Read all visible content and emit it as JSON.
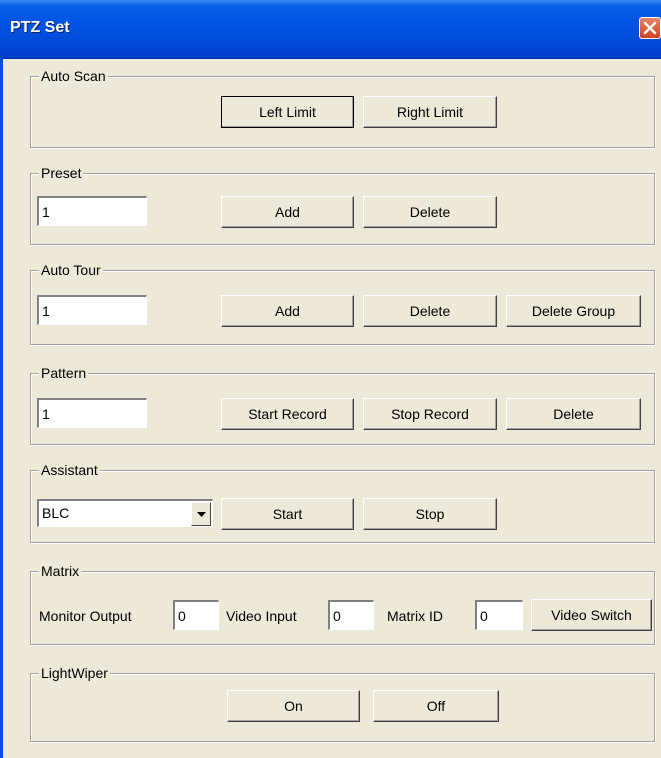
{
  "window": {
    "title": "PTZ Set"
  },
  "auto_scan": {
    "label": "Auto Scan",
    "left_limit": "Left Limit",
    "right_limit": "Right Limit"
  },
  "preset": {
    "label": "Preset",
    "value": "1",
    "add": "Add",
    "delete": "Delete"
  },
  "auto_tour": {
    "label": "Auto Tour",
    "value": "1",
    "add": "Add",
    "delete": "Delete",
    "delete_group": "Delete Group"
  },
  "pattern": {
    "label": "Pattern",
    "value": "1",
    "start_record": "Start Record",
    "stop_record": "Stop Record",
    "delete": "Delete"
  },
  "assistant": {
    "label": "Assistant",
    "selected": "BLC",
    "start": "Start",
    "stop": "Stop"
  },
  "matrix": {
    "label": "Matrix",
    "monitor_output_label": "Monitor Output",
    "monitor_output_value": "0",
    "video_input_label": "Video Input",
    "video_input_value": "0",
    "matrix_id_label": "Matrix ID",
    "matrix_id_value": "0",
    "video_switch": "Video Switch"
  },
  "light_wiper": {
    "label": "LightWiper",
    "on": "On",
    "off": "Off"
  },
  "colors": {
    "titlebar": "#0053e2",
    "close": "#d5401d",
    "dialog_bg": "#ece9d8"
  },
  "icons": {
    "close": "close-icon",
    "dropdown": "chevron-down-icon"
  }
}
